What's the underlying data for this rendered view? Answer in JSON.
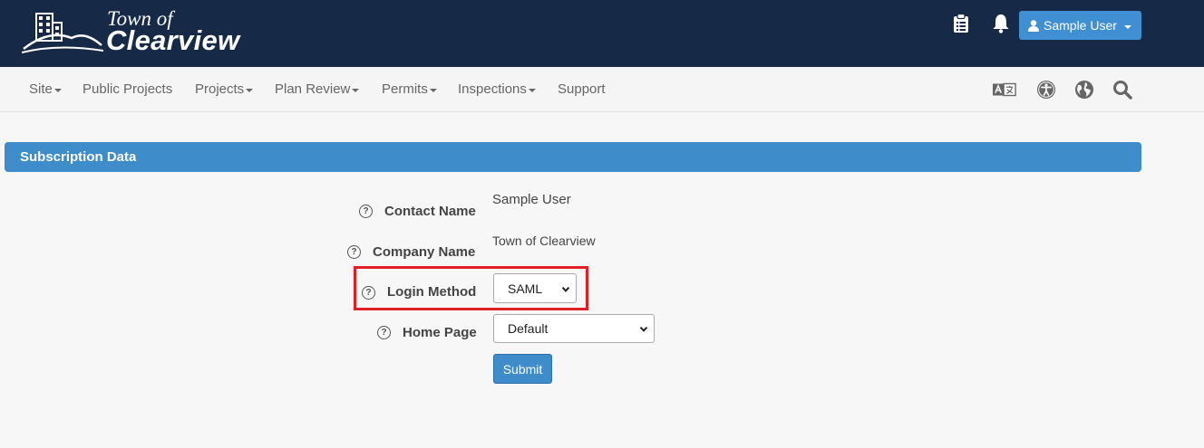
{
  "header": {
    "logo_small": "Town of",
    "logo_big": "Clearview",
    "user_label": "Sample User"
  },
  "nav": {
    "items": [
      {
        "label": "Site",
        "dropdown": true
      },
      {
        "label": "Public Projects",
        "dropdown": false
      },
      {
        "label": "Projects",
        "dropdown": true
      },
      {
        "label": "Plan Review",
        "dropdown": true
      },
      {
        "label": "Permits",
        "dropdown": true
      },
      {
        "label": "Inspections",
        "dropdown": true
      },
      {
        "label": "Support",
        "dropdown": false
      }
    ],
    "tools": [
      "translate-icon",
      "accessibility-icon",
      "globe-icon",
      "search-icon"
    ]
  },
  "panel": {
    "title": "Subscription Data"
  },
  "form": {
    "contact_name_label": "Contact Name",
    "contact_name_value": "Sample User",
    "company_name_label": "Company Name",
    "company_name_value": "Town of Clearview",
    "login_method_label": "Login Method",
    "login_method_value": "SAML",
    "home_page_label": "Home Page",
    "home_page_value": "Default",
    "submit_label": "Submit"
  },
  "colors": {
    "header_bg": "#162a47",
    "accent": "#3f8ccb",
    "highlight": "#e01f27"
  }
}
